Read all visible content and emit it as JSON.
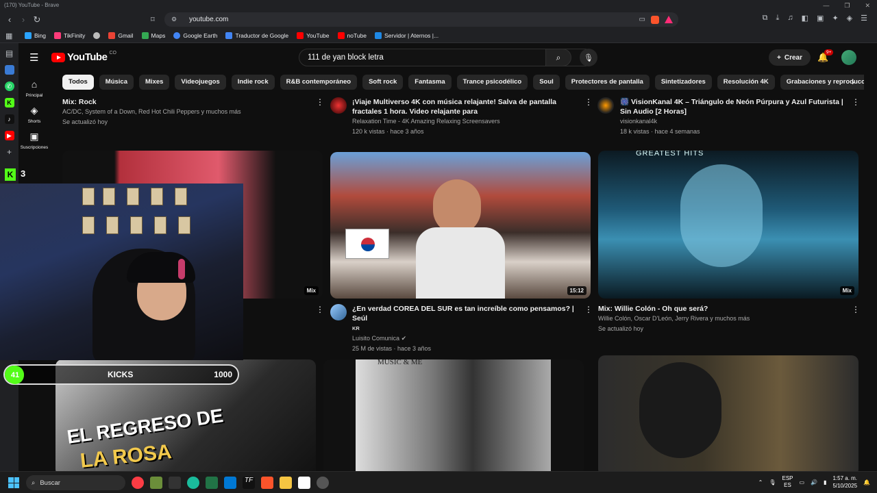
{
  "window": {
    "title": "(170) YouTube - Brave"
  },
  "browser": {
    "url": "youtube.com",
    "bookmarks": [
      "Bing",
      "TikFinity",
      "Gmail",
      "Maps",
      "Google Earth",
      "Traductor de Google",
      "YouTube",
      "noTube",
      "Servidor | Aternos |..."
    ],
    "bookmark_colors": [
      "#2aa3ff",
      "#ff3b7a",
      "#ea4335",
      "#34a853",
      "#4285f4",
      "#4285f4",
      "#ff0000",
      "#ff0000",
      "#1e88e5"
    ]
  },
  "youtube": {
    "logo_text": "YouTube",
    "country": "CO",
    "search_value": "111 de yan block letra",
    "create_label": "Crear",
    "notif_count": "9+",
    "guide": [
      {
        "icon": "home-icon",
        "label": "Principal"
      },
      {
        "icon": "shorts-icon",
        "label": "Shorts"
      },
      {
        "icon": "subscriptions-icon",
        "label": "Suscripciones"
      }
    ],
    "chips": [
      "Todos",
      "Música",
      "Mixes",
      "Videojuegos",
      "Indie rock",
      "R&B contemporáneo",
      "Soft rock",
      "Fantasma",
      "Trance psicodélico",
      "Soul",
      "Protectores de pantalla",
      "Sintetizadores",
      "Resolución 4K",
      "Grabaciones y reproducciones de sonido"
    ],
    "row1": [
      {
        "title": "Mix: Rock",
        "line1": "AC/DC, System of a Down, Red Hot Chili Peppers y muchos más",
        "line2": "Se actualizó hoy"
      },
      {
        "title": "¡Viaje Multiverso 4K con música relajante! Salva de pantalla fractales 1 hora. Video relajante para",
        "line1": "Relaxation Time - 4K Amazing Relaxing Screensavers",
        "line2": "120 k vistas · hace 3 años"
      },
      {
        "title": "🎆 VisionKanal 4K – Triángulo de Neón Púrpura y Azul Futurista | Sin Audio [2 Horas]",
        "line1": "visionkanal4k",
        "line2": "18 k vistas · hace 4 semanas"
      }
    ],
    "row2": [
      {
        "badge": "Mix"
      },
      {
        "badge": "15:12",
        "title": "¿En verdad COREA DEL SUR es tan increíble como pensamos? | Seúl",
        "tag": "KR",
        "channel": "Luisito Comunica",
        "meta": "25 M de vistas · hace 3 años"
      },
      {
        "badge": "Mix",
        "title": "Mix: Willie Colón - Oh que será?",
        "line1": "Willie Colón, Oscar D'León, Jerry Rivera y muchos más",
        "line2": "Se actualizó hoy",
        "thumb_text": "GREATEST HITS"
      }
    ],
    "row3": [
      {
        "thumb_text": "EL REGRESO DE",
        "thumb_text2": "LA ROSA"
      },
      {
        "thumb_text": "MUSIC & ME"
      },
      {}
    ]
  },
  "stream_overlay": {
    "kick_logo": "K",
    "kick_count": "3",
    "bar_current": "41",
    "bar_label": "KICKS",
    "bar_target": "1000",
    "bar_progress": 0.041
  },
  "taskbar": {
    "search_label": "Buscar",
    "lang1": "ESP",
    "lang2": "ES",
    "time": "1:57 a. m.",
    "date": "5/10/2025"
  }
}
